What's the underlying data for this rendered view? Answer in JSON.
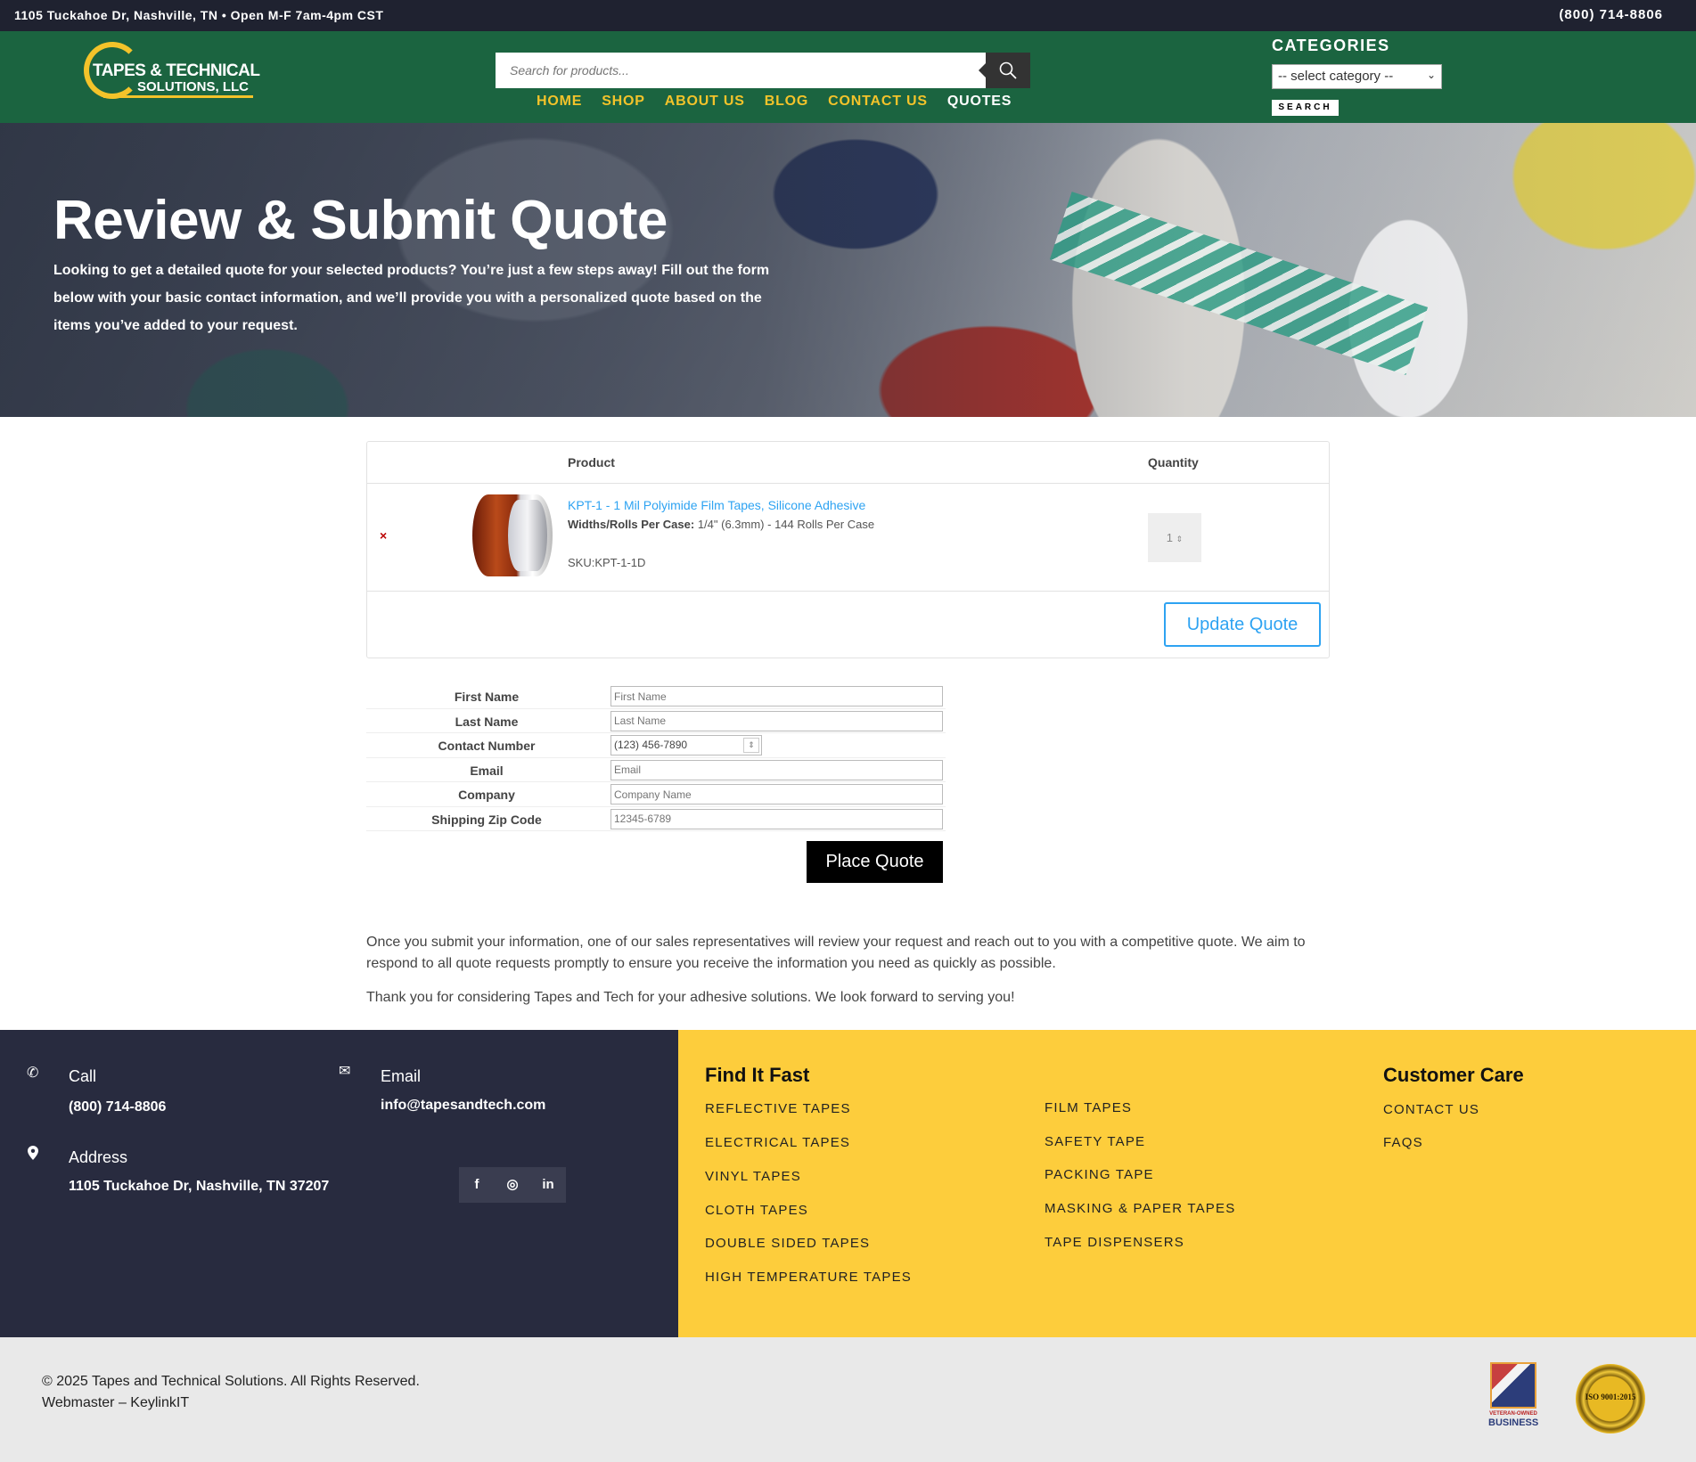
{
  "topbar": {
    "address": "1105 Tuckahoe Dr, Nashville, TN • Open M-F 7am-4pm CST",
    "phone": "(800) 714-8806"
  },
  "header": {
    "logo_line1": "TAPES & TECHNICAL",
    "logo_line2": "SOLUTIONS, LLC",
    "search_placeholder": "Search for products...",
    "nav": [
      "HOME",
      "SHOP",
      "ABOUT US",
      "BLOG",
      "CONTACT US",
      "QUOTES"
    ],
    "categories_title": "CATEGORIES",
    "category_select": "-- select category --",
    "category_search_btn": "SEARCH"
  },
  "hero": {
    "title": "Review & Submit Quote",
    "description": "Looking to get a detailed quote for your selected products? You’re just a few steps away! Fill out the form below with your basic contact information, and we’ll provide you with a personalized quote based on the items you’ve added to your request."
  },
  "quote_table": {
    "col_product": "Product",
    "col_quantity": "Quantity",
    "item": {
      "remove_glyph": "×",
      "title": "KPT-1 - 1 Mil Polyimide Film Tapes, Silicone Adhesive",
      "attr_label": "Widths/Rolls Per Case:",
      "attr_value": "1/4\" (6.3mm) - 144 Rolls Per Case",
      "sku": "SKU:KPT-1-1D",
      "quantity": "1"
    },
    "update_btn": "Update Quote"
  },
  "form": {
    "fields": [
      {
        "label": "First Name",
        "placeholder": "First Name"
      },
      {
        "label": "Last Name",
        "placeholder": "Last Name"
      },
      {
        "label": "Contact Number",
        "placeholder": "(123) 456-7890"
      },
      {
        "label": "Email",
        "placeholder": "Email"
      },
      {
        "label": "Company",
        "placeholder": "Company Name"
      },
      {
        "label": "Shipping Zip Code",
        "placeholder": "12345-6789"
      }
    ],
    "submit_btn": "Place Quote"
  },
  "notes": {
    "p1": "Once you submit your information, one of our sales representatives will review your request and reach out to you with a competitive quote. We aim to respond to all quote requests promptly to ensure you receive the information you need as quickly as possible.",
    "p2": "Thank you for considering Tapes and Tech for your adhesive solutions. We look forward to serving you!"
  },
  "footer": {
    "call_label": "Call",
    "call_value": "(800) 714-8806",
    "email_label": "Email",
    "email_value": "info@tapesandtech.com",
    "address_label": "Address",
    "address_value": "1105 Tuckahoe Dr, Nashville, TN 37207",
    "social": [
      "f",
      "◎",
      "in"
    ],
    "find_title": "Find It Fast",
    "find_col1": [
      "REFLECTIVE TAPES",
      "ELECTRICAL TAPES",
      "VINYL TAPES",
      "CLOTH TAPES",
      "DOUBLE SIDED TAPES",
      "HIGH TEMPERATURE TAPES"
    ],
    "find_col2": [
      "FILM TAPES",
      "SAFETY TAPE",
      "PACKING TAPE",
      "MASKING & PAPER TAPES",
      "TAPE DISPENSERS"
    ],
    "care_title": "Customer Care",
    "care_links": [
      "CONTACT US",
      "FAQS"
    ]
  },
  "bottom": {
    "copyright": "© 2025 Tapes and Technical Solutions. All Rights Reserved.",
    "webmaster": "Webmaster – KeylinkIT",
    "vet_caption": "VETERAN-OWNED",
    "vet_business": "BUSINESS",
    "iso_label": "ISO 9001:2015"
  },
  "colors": {
    "header_green": "#1b6440",
    "nav_yellow": "#f3c32a",
    "link_blue": "#2ea3f2",
    "footer_dark": "#282b3f",
    "footer_yellow": "#fdcd3c"
  }
}
